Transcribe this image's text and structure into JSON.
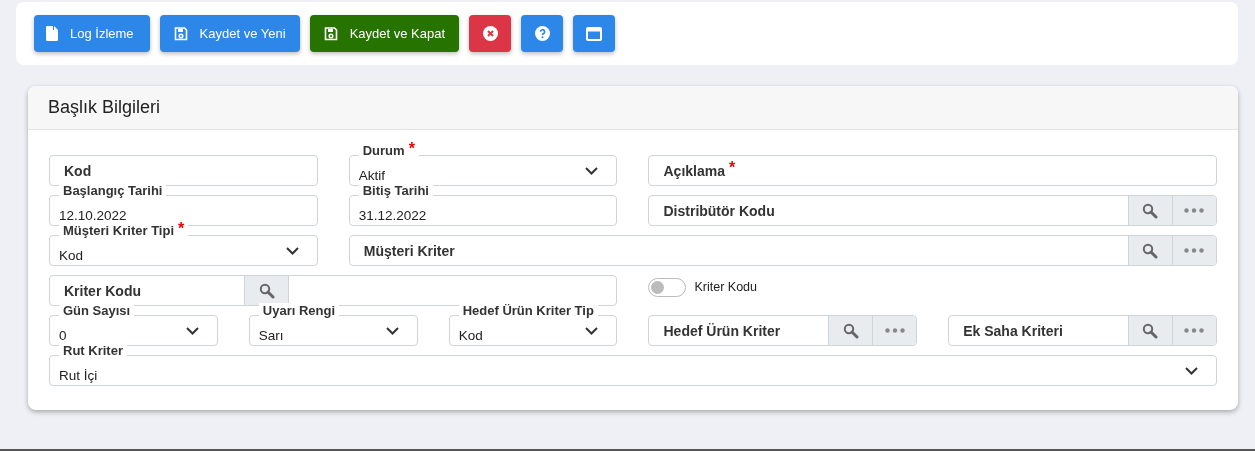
{
  "toolbar": [
    {
      "kind": "file",
      "label": "Log İzleme",
      "color": "#2c87e8"
    },
    {
      "kind": "save",
      "label": "Kaydet ve Yeni",
      "color": "#2c87e8"
    },
    {
      "kind": "save",
      "label": "Kaydet ve Kapat",
      "color": "#267300"
    },
    {
      "kind": "close",
      "color": "#dc3545"
    },
    {
      "kind": "help",
      "color": "#2c87e8"
    },
    {
      "kind": "window",
      "color": "#2c87e8"
    }
  ],
  "card": {
    "title": "Başlık Bilgileri",
    "rows": [
      [
        {
          "kind": "text",
          "label": "Kod"
        },
        {
          "kind": "select",
          "label": "Durum",
          "required_mark": "*",
          "value": "Aktif"
        },
        {
          "kind": "text",
          "label": "Açıklama",
          "required_mark": "*"
        }
      ],
      [
        {
          "kind": "date",
          "label": "Başlangıç Tarihi",
          "value": "12.10.2022"
        },
        {
          "kind": "date",
          "label": "Bitiş Tarihi",
          "value": "31.12.2022"
        },
        {
          "kind": "lookup",
          "label": "Distribütör Kodu"
        }
      ],
      [
        {
          "kind": "select",
          "label": "Müşteri Kriter Tipi",
          "required_mark": "*",
          "value": "Kod"
        },
        {
          "kind": "lookup",
          "label": "Müşteri Kriter"
        }
      ],
      [
        {
          "kind": "search",
          "label": "Kriter Kodu"
        },
        "",
        {
          "kind": "toggle",
          "label": "Kriter Kodu",
          "on": false
        }
      ],
      [
        {
          "kind": "select",
          "label": "Gün Sayısı",
          "value": "0"
        },
        {
          "kind": "select",
          "label": "Uyarı Rengi",
          "value": "Sarı"
        },
        {
          "kind": "select",
          "label": "Hedef Ürün Kriter Tip",
          "value": "Kod"
        },
        {
          "kind": "lookup",
          "label": "Hedef Ürün Kriter"
        },
        {
          "kind": "lookup",
          "label": "Ek Saha Kriteri"
        }
      ],
      [
        {
          "kind": "select",
          "label": "Rut Kriter",
          "value": "Rut İçi"
        }
      ]
    ]
  }
}
